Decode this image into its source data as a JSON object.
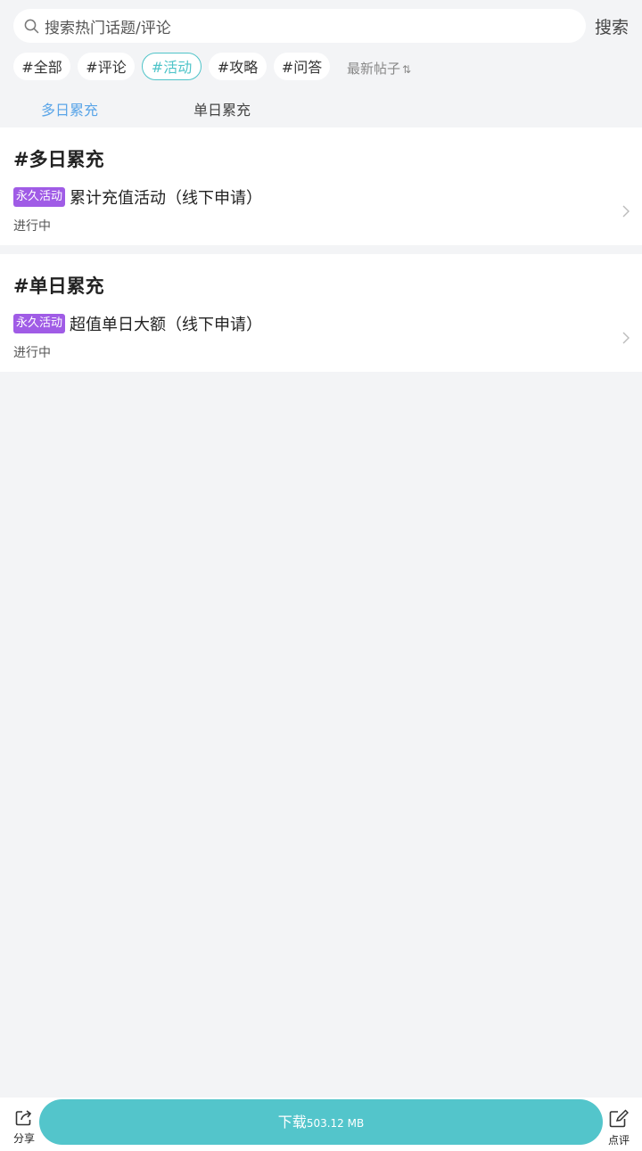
{
  "search": {
    "placeholder": "搜索热门话题/评论",
    "button": "搜索"
  },
  "tags": [
    {
      "label": "#全部",
      "active": false
    },
    {
      "label": "#评论",
      "active": false
    },
    {
      "label": "#活动",
      "active": true
    },
    {
      "label": "#攻略",
      "active": false
    },
    {
      "label": "#问答",
      "active": false
    }
  ],
  "sort": {
    "label": "最新帖子"
  },
  "sub_tabs": [
    {
      "label": "多日累充",
      "active": true
    },
    {
      "label": "单日累充",
      "active": false
    }
  ],
  "sections": [
    {
      "title": "#多日累充",
      "items": [
        {
          "badge": "永久活动",
          "title": "累计充值活动（线下申请）",
          "status": "进行中"
        }
      ]
    },
    {
      "title": "#单日累充",
      "items": [
        {
          "badge": "永久活动",
          "title": "超值单日大额（线下申请）",
          "status": "进行中"
        }
      ]
    }
  ],
  "bottom": {
    "share_label": "分享",
    "download_label": "下载",
    "download_size": "503.12 MB",
    "review_label": "点评"
  },
  "colors": {
    "accent": "#53c5cb",
    "active_tag": "#4fc4c9",
    "active_subtab": "#5aa5e8",
    "badge": "#a05ce6",
    "background": "#f3f4f6"
  },
  "icons": [
    "search-icon",
    "sort-icon",
    "chevron-right-icon",
    "share-icon",
    "edit-icon"
  ]
}
